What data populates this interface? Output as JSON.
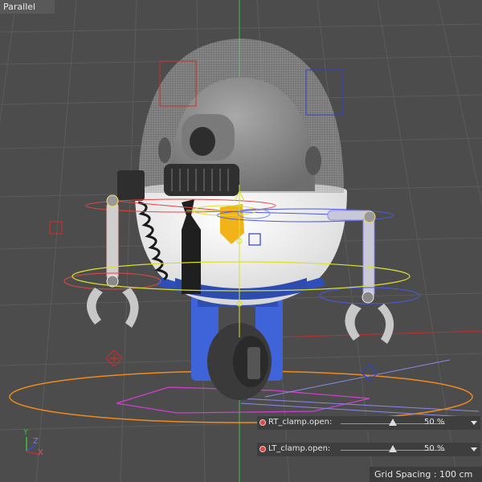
{
  "viewport": {
    "view_label": "Parallel",
    "grid_spacing": "Grid Spacing : 100 cm",
    "axis": {
      "y": "Y",
      "z": "Z",
      "x": "X"
    },
    "colors": {
      "background": "#4c4c4c",
      "grid": "#5a5a5a",
      "rig_right": "#e04848",
      "rig_left": "#4b5ae0",
      "ground_ring": "#f08a1e",
      "waist_ring": "#d8e030",
      "selection": "#d040d0"
    }
  },
  "sliders": [
    {
      "name": "RT_clamp.open:",
      "value_text": "50 %",
      "value": 50,
      "icon": "dot-icon"
    },
    {
      "name": "LT_clamp.open:",
      "value_text": "50 %",
      "value": 50,
      "icon": "dot-icon"
    }
  ]
}
